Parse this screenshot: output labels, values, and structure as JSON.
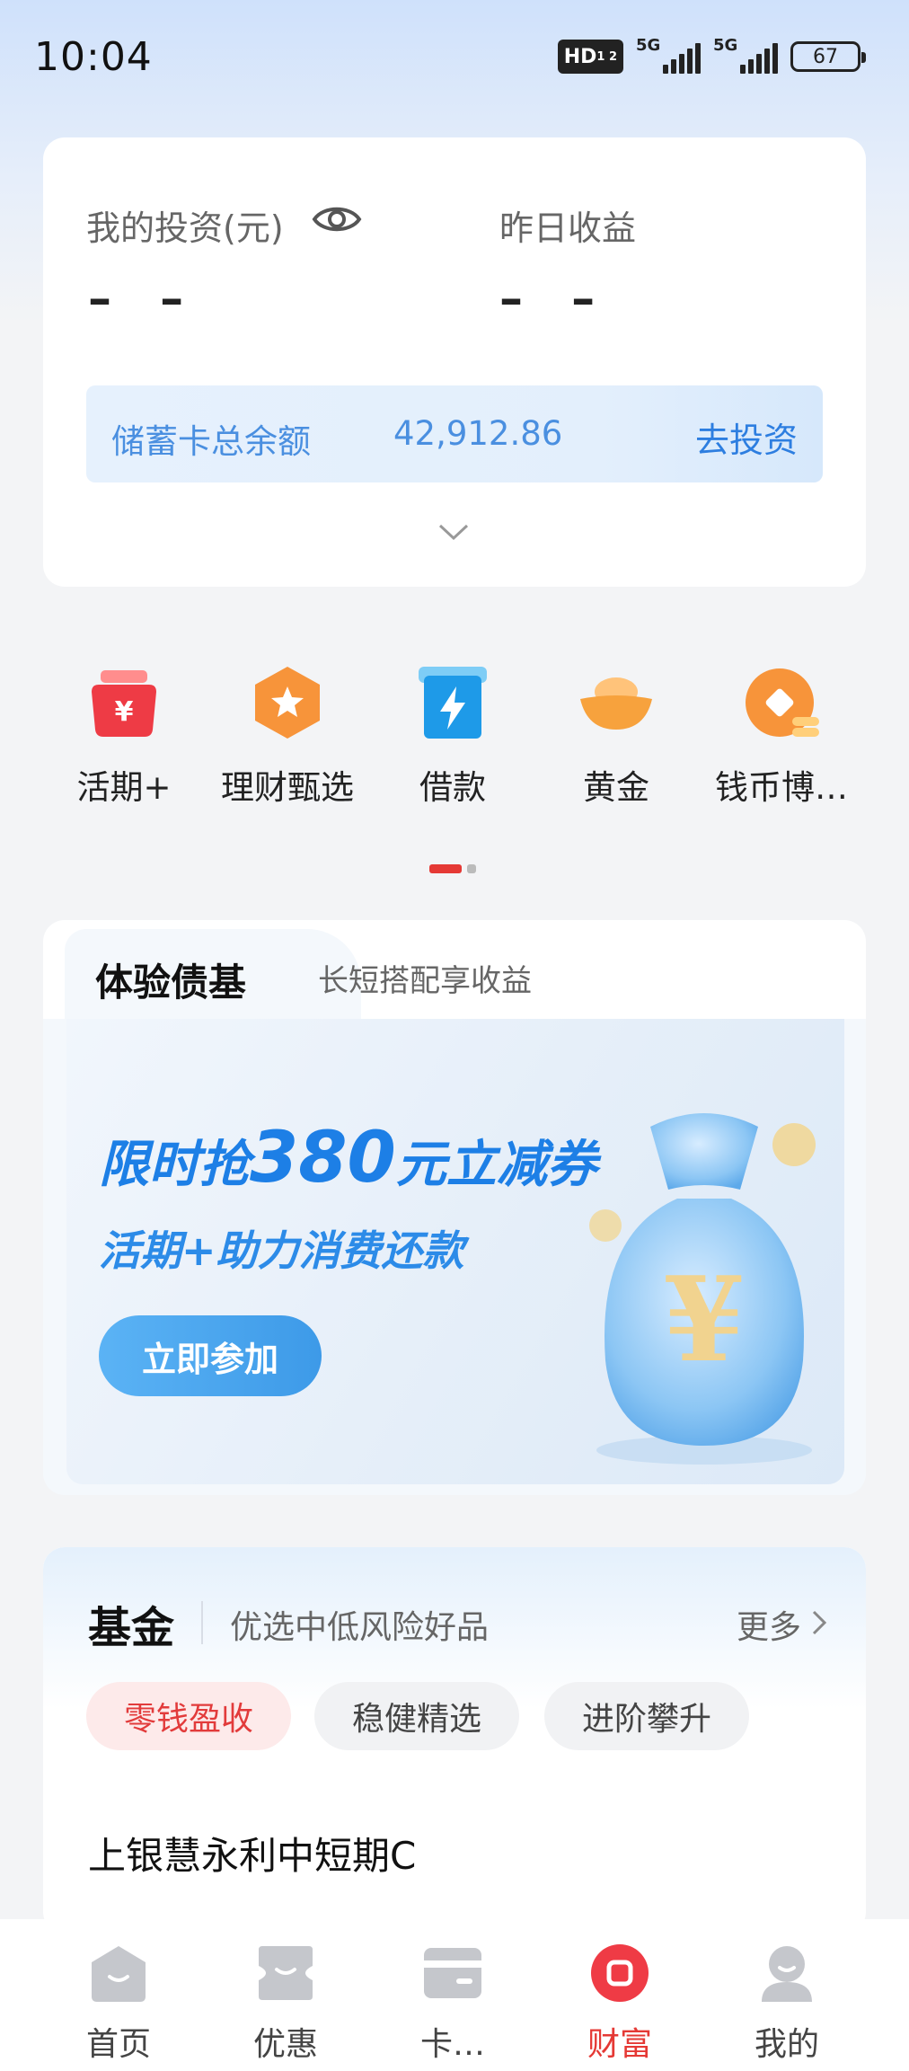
{
  "status_bar": {
    "time": "10:04",
    "hd_label": "HD",
    "hd_sub": "1 2",
    "network1": "5G",
    "network2": "5G",
    "battery": "67"
  },
  "investment": {
    "my_investment_label": "我的投资(元)",
    "my_investment_value": "– –",
    "yesterday_income_label": "昨日收益",
    "yesterday_income_value": "– –",
    "savings_balance_label": "储蓄卡总余额",
    "savings_balance_value": "42,912.86",
    "go_invest_label": "去投资"
  },
  "quick_menu": {
    "items": [
      {
        "label": "活期+",
        "icon": "money-bag-yuan-icon"
      },
      {
        "label": "理财甄选",
        "icon": "star-hexagon-icon"
      },
      {
        "label": "借款",
        "icon": "lightning-card-icon"
      },
      {
        "label": "黄金",
        "icon": "gold-ingot-icon"
      },
      {
        "label": "钱币博…",
        "icon": "coin-icon"
      }
    ]
  },
  "promo": {
    "tab_title": "体验债基",
    "tab_subtitle": "长短搭配享收益",
    "banner_title_pre": "限时抢",
    "banner_title_num": "380",
    "banner_title_post": "元立减券",
    "banner_subtitle": "活期+助力消费还款",
    "banner_button": "立即参加"
  },
  "fund": {
    "title": "基金",
    "subtitle": "优选中低风险好品",
    "more_label": "更多",
    "chips": [
      "零钱盈收",
      "稳健精选",
      "进阶攀升"
    ],
    "active_chip": 0,
    "first_item": "上银慧永利中短期C"
  },
  "bottom_nav": {
    "items": [
      {
        "label": "首页",
        "icon": "home-icon"
      },
      {
        "label": "优惠",
        "icon": "ticket-icon"
      },
      {
        "label": "卡…",
        "icon": "card-icon"
      },
      {
        "label": "财富",
        "icon": "wealth-icon"
      },
      {
        "label": "我的",
        "icon": "profile-icon"
      }
    ],
    "active_index": 3
  },
  "colors": {
    "accent_red": "#e53935",
    "accent_blue": "#2d7ee0"
  }
}
